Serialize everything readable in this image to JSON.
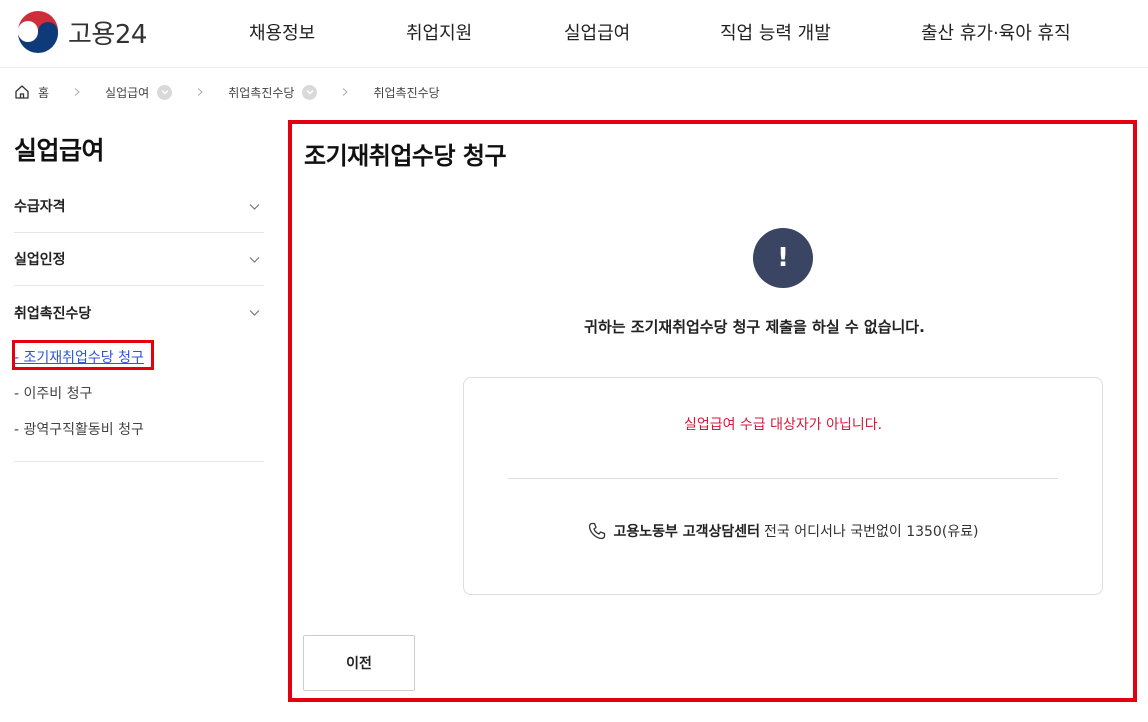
{
  "header": {
    "logo_text": "고용24",
    "nav": [
      {
        "label": "채용정보"
      },
      {
        "label": "취업지원"
      },
      {
        "label": "실업급여"
      },
      {
        "label": "직업 능력 개발"
      },
      {
        "label": "출산 휴가·육아 휴직"
      }
    ]
  },
  "breadcrumb": {
    "home": "홈",
    "level1": "실업급여",
    "level2": "취업촉진수당",
    "level3": "취업촉진수당"
  },
  "sidebar": {
    "title": "실업급여",
    "items": [
      {
        "label": "수급자격"
      },
      {
        "label": "실업인정"
      },
      {
        "label": "취업촉진수당"
      }
    ],
    "sub_items": [
      {
        "label": "- 조기재취업수당 청구"
      },
      {
        "label": "- 이주비 청구"
      },
      {
        "label": "- 광역구직활동비 청구"
      }
    ]
  },
  "main": {
    "title": "조기재취업수당 청구",
    "alert_symbol": "!",
    "message": "귀하는 조기재취업수당 청구 제출을 하실 수 없습니다.",
    "reason": "실업급여 수급 대상자가 아닙니다.",
    "call_center_name": "고용노동부 고객상담센터",
    "call_center_info": "전국 어디서나 국번없이 1350(유료)",
    "prev_button": "이전"
  },
  "colors": {
    "highlight_red": "#e3000f",
    "alert_navy": "#3a4463",
    "reason_red": "#d6183d",
    "link_blue": "#2e55d8"
  },
  "icons": [
    "logo-mark-icon",
    "home-icon",
    "chevron-right-icon",
    "chevron-down-icon",
    "alert-icon",
    "phone-icon"
  ]
}
